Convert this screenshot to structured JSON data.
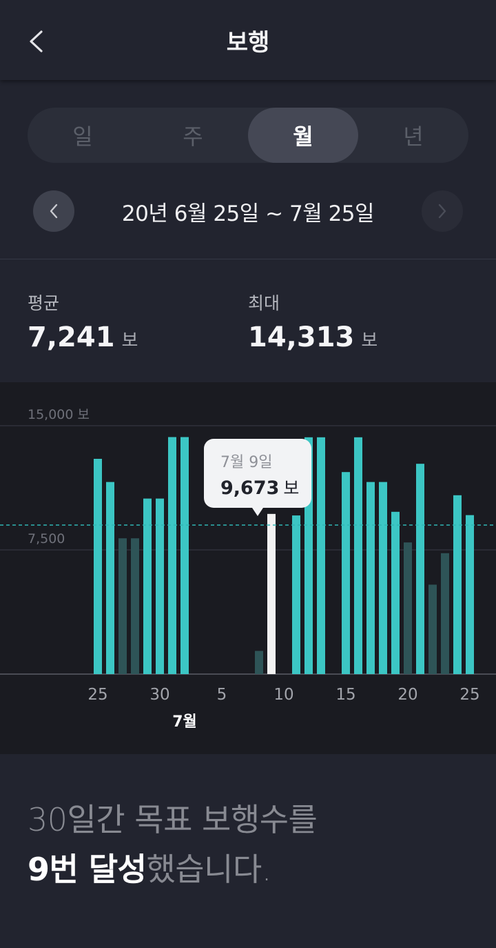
{
  "header": {
    "title": "보행"
  },
  "tabs": [
    {
      "label": "일",
      "active": false
    },
    {
      "label": "주",
      "active": false
    },
    {
      "label": "월",
      "active": true
    },
    {
      "label": "년",
      "active": false
    }
  ],
  "date_range": {
    "label": "20년 6월 25일 ~ 7월 25일"
  },
  "stats": {
    "average": {
      "label": "평균",
      "value": "7,241",
      "unit": "보"
    },
    "max": {
      "label": "최대",
      "value": "14,313",
      "unit": "보"
    }
  },
  "tooltip": {
    "date": "7월 9일",
    "value": "9,673",
    "unit": "보"
  },
  "summary": {
    "line1": "30일간 목표 보행수를",
    "count": "9번 달성",
    "suffix": "했습니다."
  },
  "colors": {
    "goal_met": "#3cc6c4",
    "goal_missed": "#2e5457",
    "selected": "#f2f2f2",
    "goal_line": "#2fb6b4"
  },
  "chart_data": {
    "type": "bar",
    "y_tick_labels": [
      "15,000 보",
      "7,500"
    ],
    "y_ticks": [
      15000,
      7500
    ],
    "ylim": [
      0,
      15000
    ],
    "goal": 9000,
    "month_label": "7월",
    "x_tick_labels": [
      "25",
      "30",
      "5",
      "10",
      "15",
      "20",
      "25"
    ],
    "x_tick_index": [
      0,
      5,
      10,
      15,
      20,
      25,
      30
    ],
    "selected_index": 14,
    "values": [
      13000,
      11600,
      8200,
      8200,
      10600,
      10600,
      14313,
      14313,
      0,
      0,
      0,
      0,
      0,
      1400,
      9673,
      0,
      9580,
      14300,
      14300,
      0,
      12200,
      14300,
      11600,
      11600,
      9800,
      7950,
      12700,
      5400,
      7300,
      10800,
      9600
    ]
  }
}
